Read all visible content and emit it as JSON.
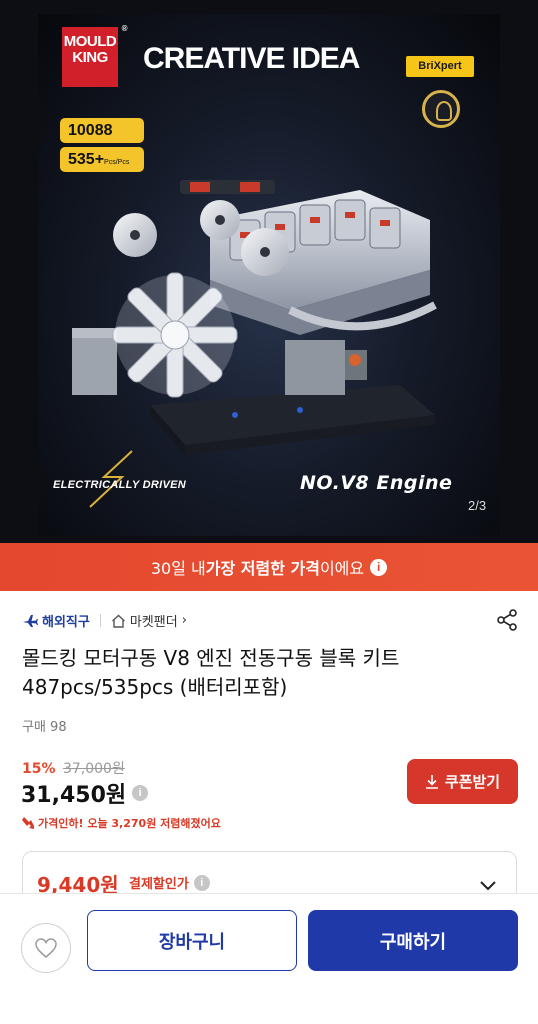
{
  "hero": {
    "brand_line1": "MOULD",
    "brand_line2": "KING",
    "brand_reg": "®",
    "title": "CREATIVE IDEA",
    "partner": "BriXpert",
    "model_number": "10088",
    "piece_count": "535+",
    "piece_unit": "Pcs/Pcs",
    "tagline": "ELECTRICALLY DRIVEN",
    "engine_name": "NO.V8 Engine",
    "pager": "2/3"
  },
  "banner": {
    "prefix": "30일 내 ",
    "highlight": "가장 저렴한 가격",
    "suffix": "이에요",
    "info_glyph": "i"
  },
  "breadcrumb": {
    "global": "해외직구",
    "store": "마켓팬더",
    "store_chevron": "›"
  },
  "product": {
    "title": "몰드킹 모터구동 V8 엔진 전동구동 블록 키트 487pcs/535pcs (배터리포함)",
    "sold": "구매 98"
  },
  "price": {
    "discount_pct": "15%",
    "original": "37,000원",
    "current": "31,450원",
    "info_glyph": "i",
    "drop_note": "가격인하! 오늘 3,270원 저렴해졌어요"
  },
  "coupon": {
    "label": "쿠폰받기"
  },
  "payment": {
    "amount": "9,440원",
    "label": "결제할인가",
    "info_glyph": "i"
  },
  "bottom": {
    "cart_label": "장바구니",
    "buy_label": "구매하기"
  },
  "colors": {
    "brand_red": "#d2202a",
    "banner_red": "#e4482f",
    "primary_blue": "#1f3aa8",
    "price_red": "#d83a26"
  }
}
